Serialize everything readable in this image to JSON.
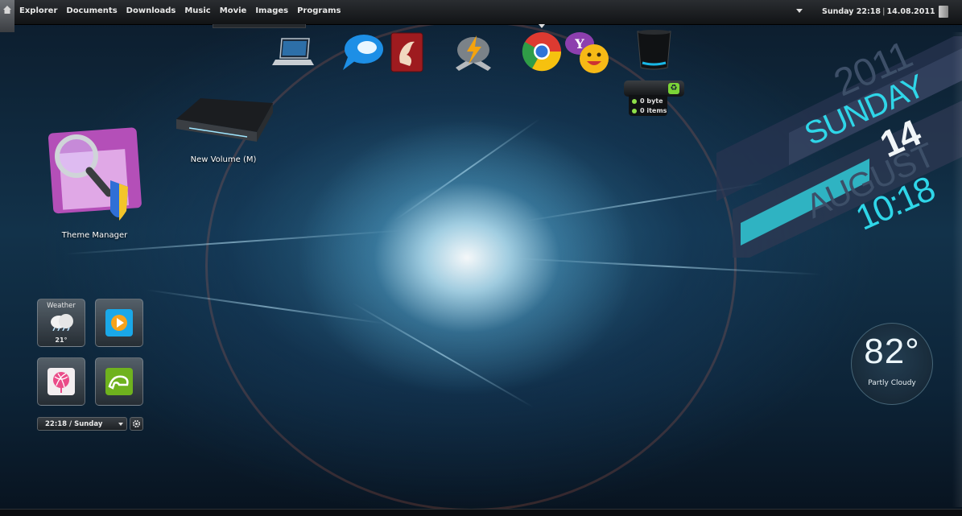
{
  "menu": {
    "items": [
      "Explorer",
      "Documents",
      "Downloads",
      "Music",
      "Movie",
      "Images",
      "Programs"
    ],
    "clock_day_time": "Sunday 22:18",
    "clock_date": "14.08.2011"
  },
  "desktop": {
    "drive_label": "New Volume (M)",
    "theme_label": "Theme Manager"
  },
  "recycle": {
    "size": "0 byte",
    "count": "0 items"
  },
  "tiles": {
    "weather_label": "Weather",
    "weather_temp": "21°",
    "time_select_value": "22:18 / Sunday"
  },
  "date_widget": {
    "year": "2011",
    "weekday": "SUNDAY",
    "day": "14",
    "month": "AUGUST",
    "time": "10:18"
  },
  "weather_widget": {
    "temp": "82°",
    "condition": "Partly Cloudy"
  },
  "colors": {
    "accent_cyan": "#2fd6e8",
    "date_dark": "#3d4f68",
    "topbar": "#1a1c1f"
  },
  "icons": [
    "home-icon",
    "laptop-icon",
    "pidgin-icon",
    "firefox-alt-icon",
    "winamp-icon",
    "chrome-icon",
    "yahoo-messenger-icon",
    "recycle-bin-icon",
    "drive-icon",
    "theme-manager-icon",
    "weather-cloud-icon",
    "play-icon",
    "dribbble-icon",
    "deviantart-icon",
    "gear-icon",
    "trash-icon"
  ]
}
